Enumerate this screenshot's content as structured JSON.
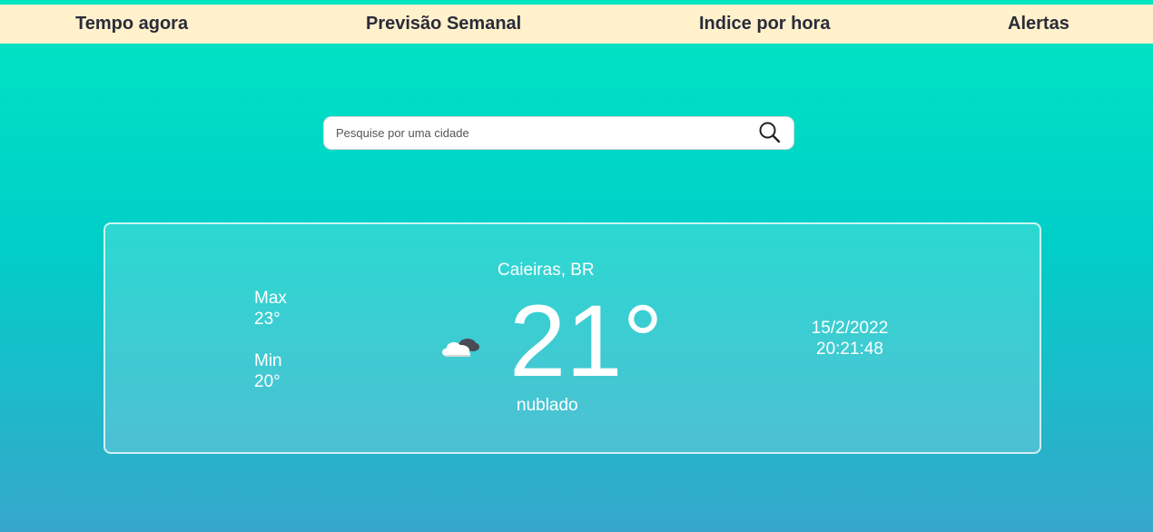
{
  "nav": {
    "items": [
      {
        "label": "Tempo agora"
      },
      {
        "label": "Previsão Semanal"
      },
      {
        "label": "Indice por hora"
      },
      {
        "label": "Alertas"
      }
    ]
  },
  "search": {
    "placeholder": "Pesquise por uma cidade",
    "value": "",
    "icon": "search-icon"
  },
  "weather": {
    "city": "Caieiras, BR",
    "temperature": "21°",
    "description": "nublado",
    "icon": "cloudy-night-icon",
    "max_label": "Max",
    "max_value": "23°",
    "min_label": "Min",
    "min_value": "20°",
    "date": "15/2/2022",
    "time": "20:21:48"
  },
  "colors": {
    "nav_background": "#fff1cc",
    "nav_text": "#2b2b3a",
    "gradient_top": "#00e6c2",
    "gradient_bottom": "#36a7cb",
    "card_text": "#ffffff"
  }
}
